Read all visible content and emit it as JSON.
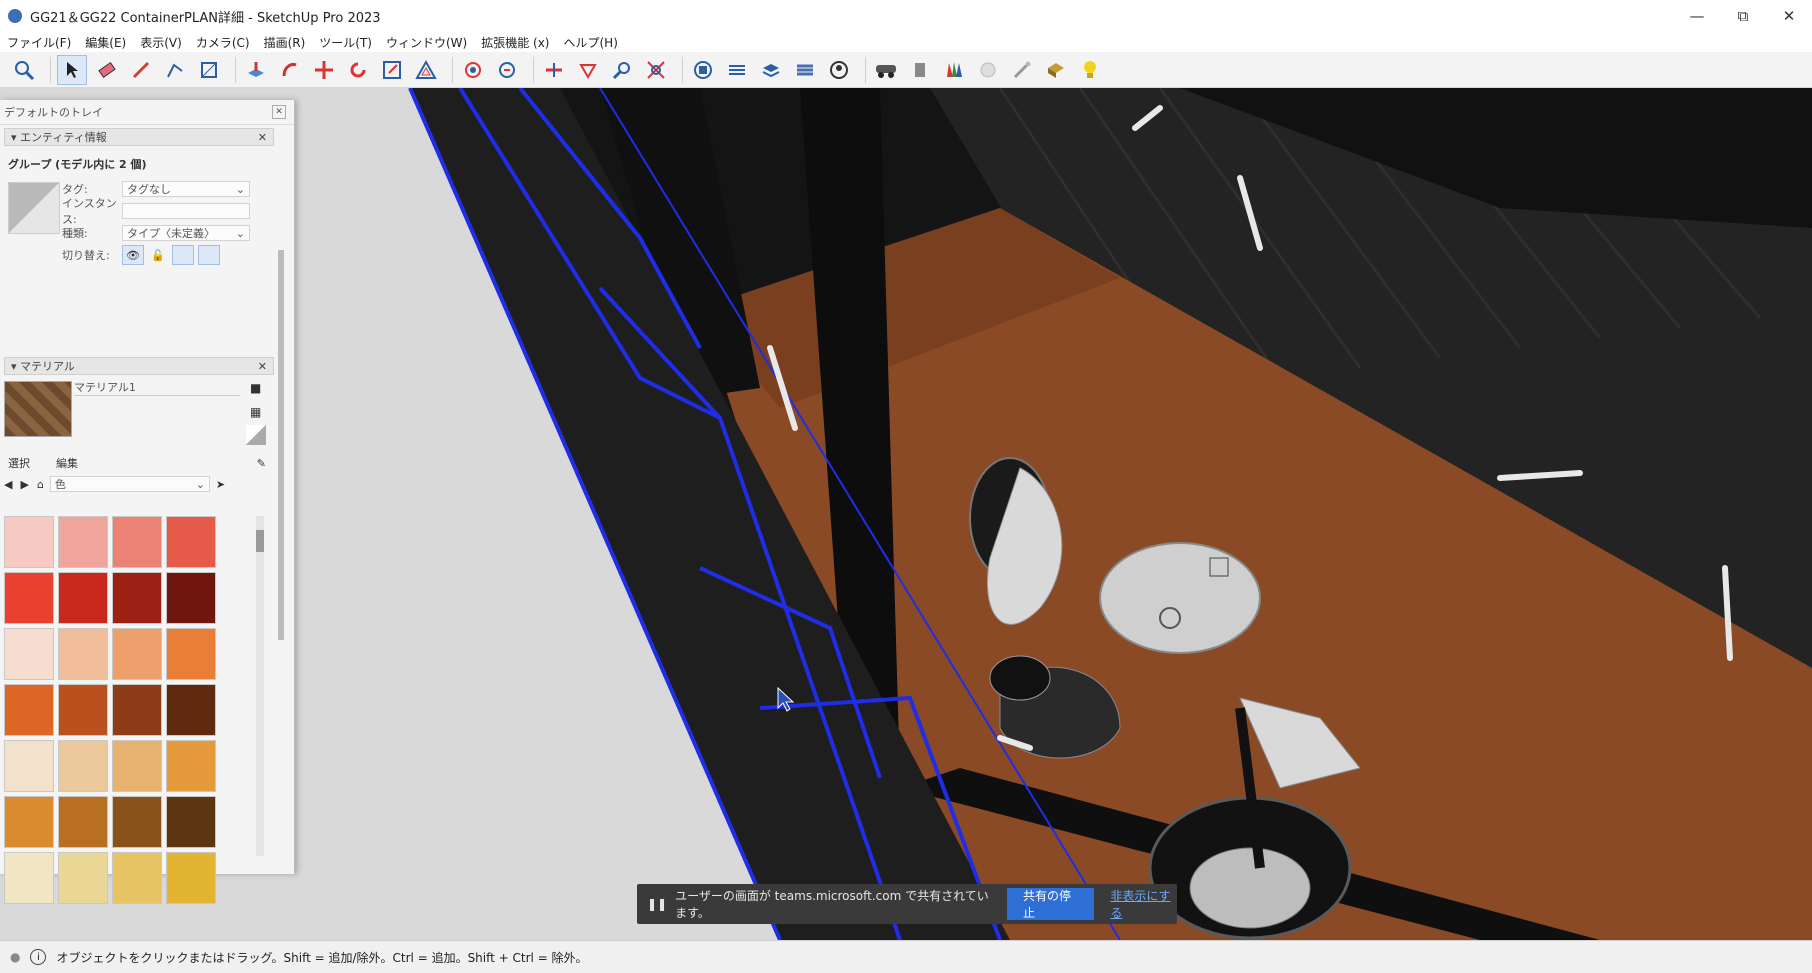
{
  "window": {
    "title": "GG21＆GG22 ContainerPLAN詳細 - SketchUp Pro 2023"
  },
  "menu": [
    "ファイル(F)",
    "編集(E)",
    "表示(V)",
    "カメラ(C)",
    "描画(R)",
    "ツール(T)",
    "ウィンドウ(W)",
    "拡張機能 (x)",
    "ヘルプ(H)"
  ],
  "toolbar_icons": [
    "zoom-icon",
    "select-icon",
    "eraser-icon",
    "pencil-icon",
    "line-icon",
    "shape-icon",
    "pushpull-icon",
    "followme-icon",
    "move-icon",
    "rotate-icon",
    "scale-icon",
    "offset-icon",
    "orbit-icon",
    "pan-icon",
    "section-icon",
    "tape-icon",
    "zoom-tool-icon",
    "zoom-extents-icon",
    "warehouse-icon",
    "extension-icon",
    "layers-icon",
    "styles-icon",
    "user-icon",
    "vehicle-icon",
    "outliner-icon",
    "materials-icon",
    "fog-icon",
    "tools-icon",
    "component-icon",
    "light-icon"
  ],
  "tray": {
    "title": "デフォルトのトレイ",
    "entity": {
      "header": "エンティティ情報",
      "group_title": "グループ (モデル内に 2 個)",
      "tag_label": "タグ:",
      "tag_value": "タグなし",
      "instance_label": "インスタンス:",
      "instance_value": "",
      "type_label": "種類:",
      "type_value": "タイプ〈未定義〉",
      "toggle_label": "切り替え:"
    },
    "materials": {
      "header": "マテリアル",
      "material_name": "マテリアル1",
      "tab_select": "選択",
      "tab_edit": "編集",
      "library": "色"
    }
  },
  "swatches": [
    "#f6c9c3",
    "#f0a59c",
    "#ec8275",
    "#e65a4a",
    "#e9402f",
    "#c8291c",
    "#9d2015",
    "#6f160f",
    "#f7ddd0",
    "#f1bd9b",
    "#eda06c",
    "#e97f36",
    "#de6624",
    "#b9501d",
    "#8c3c16",
    "#5f2a0f",
    "#f2e2cc",
    "#ebc99c",
    "#e7b170",
    "#e59a3c",
    "#dc8a2e",
    "#b86f22",
    "#8a521b",
    "#5c3612",
    "#f1e6c4",
    "#ead796",
    "#e6c463",
    "#e2b431"
  ],
  "toast": {
    "message": "ユーザーの画面が teams.microsoft.com で共有されています。",
    "stop_label": "共有の停止",
    "hide_label": "非表示にする"
  },
  "status": {
    "text": "オブジェクトをクリックまたはドラッグ。Shift = 追加/除外。Ctrl = 追加。Shift + Ctrl = 除外。"
  }
}
